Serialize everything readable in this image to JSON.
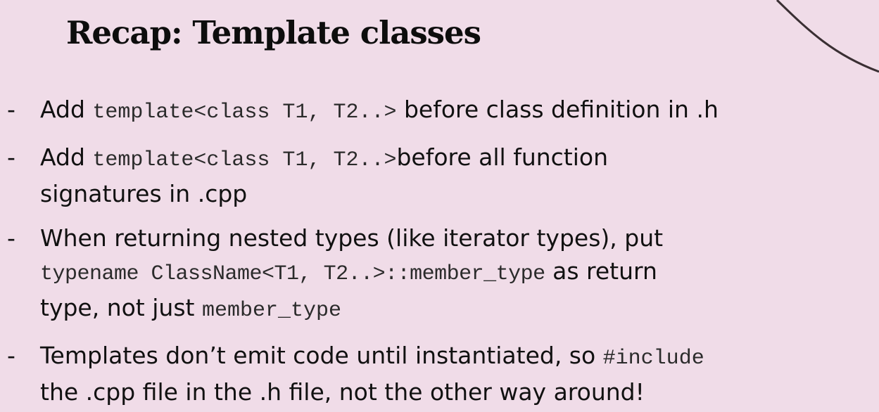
{
  "slide": {
    "title": "Recap: Template classes"
  },
  "bullets": [
    {
      "marker": "-",
      "lines": [
        [
          {
            "text": "Add ",
            "code": false
          },
          {
            "text": "template<class T1, T2..>",
            "code": true
          },
          {
            "text": " before class definition in .h",
            "code": false
          }
        ]
      ]
    },
    {
      "marker": "-",
      "lines": [
        [
          {
            "text": "Add ",
            "code": false
          },
          {
            "text": "template<class T1, T2..>",
            "code": true
          },
          {
            "text": "before all function",
            "code": false
          }
        ],
        [
          {
            "text": "signatures in .cpp",
            "code": false
          }
        ]
      ]
    },
    {
      "marker": "-",
      "lines": [
        [
          {
            "text": "When returning nested types (like iterator types), put",
            "code": false
          }
        ],
        [
          {
            "text": "typename ClassName<T1, T2..>::member_type",
            "code": true
          },
          {
            "text": " as return",
            "code": false
          }
        ],
        [
          {
            "text": "type, not just ",
            "code": false
          },
          {
            "text": "member_type",
            "code": true
          }
        ]
      ]
    },
    {
      "marker": "-",
      "lines": [
        [
          {
            "text": "Templates don’t emit code until instantiated, so ",
            "code": false
          },
          {
            "text": "#include",
            "code": true
          }
        ],
        [
          {
            "text": "the .cpp file in the .h file, not the other way around!",
            "code": false
          }
        ]
      ]
    }
  ]
}
